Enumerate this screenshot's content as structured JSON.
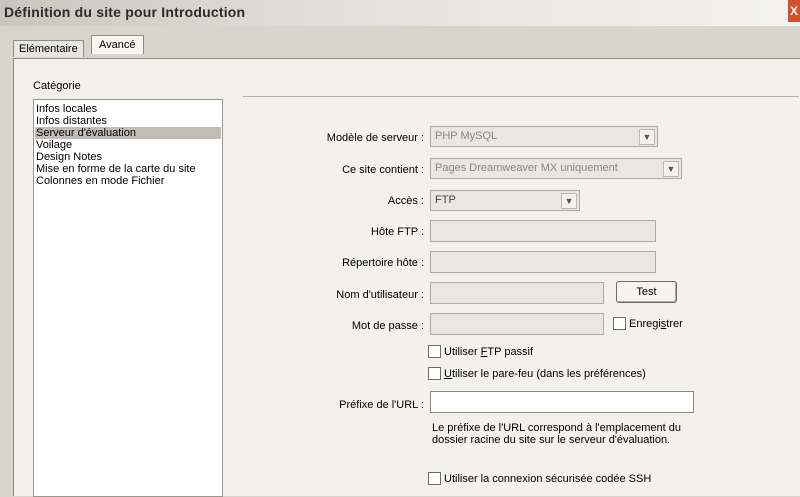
{
  "window": {
    "title": "Définition du site pour Introduction",
    "close_label": "X"
  },
  "tabs": [
    {
      "label": "Elémentaire"
    },
    {
      "label": "Avancé"
    }
  ],
  "category": {
    "label": "Catégorie",
    "items": [
      {
        "label": "Infos locales"
      },
      {
        "label": "Infos distantes"
      },
      {
        "label": "Serveur d'évaluation"
      },
      {
        "label": "Voilage"
      },
      {
        "label": "Design Notes"
      },
      {
        "label": "Mise en forme de la carte du site"
      },
      {
        "label": "Colonnes en mode Fichier"
      }
    ],
    "selected": "Serveur d'évaluation"
  },
  "form": {
    "server_model": {
      "label": "Modèle de serveur :",
      "value": "PHP MySQL"
    },
    "site_contains": {
      "label": "Ce site contient :",
      "value": "Pages Dreamweaver MX uniquement"
    },
    "access": {
      "label": "Accès :",
      "value": "FTP"
    },
    "ftp_host": {
      "label": "Hôte FTP :",
      "value": ""
    },
    "host_dir": {
      "label": "Répertoire hôte :",
      "value": ""
    },
    "username": {
      "label": "Nom d'utilisateur :",
      "value": ""
    },
    "test_button": "Test",
    "password": {
      "label": "Mot de passe :",
      "value": ""
    },
    "save": {
      "pre": "Enregi",
      "u": "s",
      "post": "trer"
    },
    "passive_ftp": {
      "pre": "Utiliser ",
      "u": "F",
      "post": "TP passif"
    },
    "firewall": {
      "pre": "",
      "u": "U",
      "post": "tiliser le pare-feu (dans les préférences)"
    },
    "url_prefix": {
      "label": "Préfixe de l'URL :",
      "value": ""
    },
    "url_note_1": "Le préfixe de l'URL correspond à l'emplacement du",
    "url_note_2": "dossier racine du site sur le serveur d'évaluation.",
    "ssh": "Utiliser la connexion sécurisée codée SSH"
  },
  "icons": {
    "dropdown": "chevron-down-icon",
    "close": "close-icon"
  }
}
